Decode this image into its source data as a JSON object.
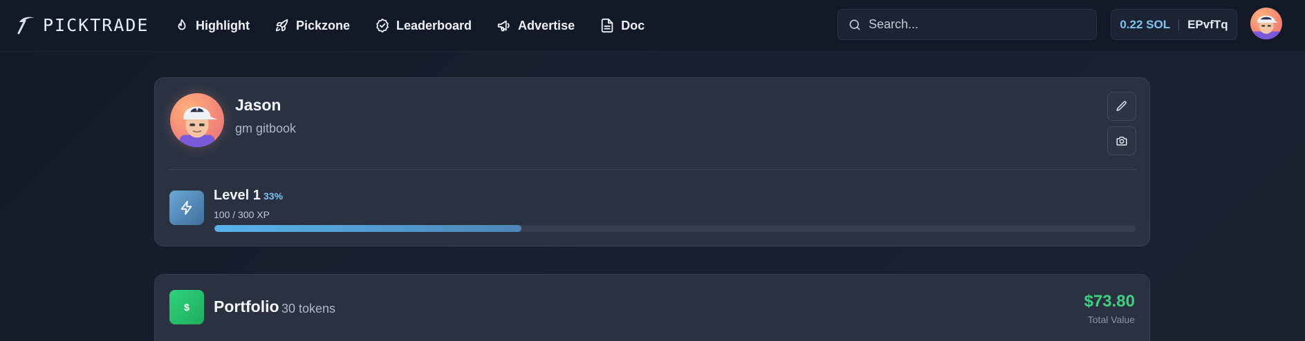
{
  "brand": {
    "name": "PICKTRADE",
    "icon": "pickaxe-icon"
  },
  "nav": {
    "links": [
      {
        "label": "Highlight",
        "icon": "flame-icon"
      },
      {
        "label": "Pickzone",
        "icon": "rocket-icon"
      },
      {
        "label": "Leaderboard",
        "icon": "badge-check-icon"
      },
      {
        "label": "Advertise",
        "icon": "megaphone-icon"
      },
      {
        "label": "Doc",
        "icon": "document-icon"
      }
    ],
    "search_placeholder": "Search...",
    "wallet": {
      "balance": "0.22 SOL",
      "address": "EPvfTq"
    }
  },
  "profile": {
    "name": "Jason",
    "bio": "gm gitbook",
    "level": {
      "title": "Level 1",
      "percent_label": "33%",
      "xp_text": "100 / 300 XP",
      "progress_fraction": 0.333
    }
  },
  "portfolio": {
    "title": "Portfolio",
    "count": "30 tokens",
    "icon_symbol": "$",
    "total_value": "$73.80",
    "total_label": "Total Value"
  },
  "colors": {
    "accent_blue": "#7cc3f2",
    "value_green": "#3fd07f",
    "background": "#161c29",
    "card": "#2a3242"
  }
}
